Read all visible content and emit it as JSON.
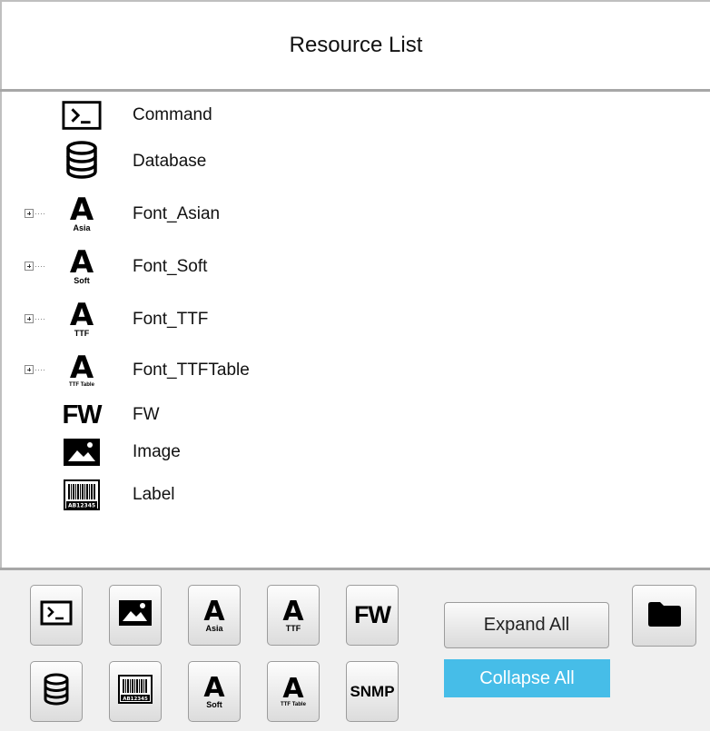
{
  "header": {
    "title": "Resource List"
  },
  "tree": {
    "items": [
      {
        "label": "Command",
        "icon": "terminal-icon",
        "expandable": false
      },
      {
        "label": "Database",
        "icon": "database-icon",
        "expandable": false
      },
      {
        "label": "Font_Asian",
        "icon": "font-asia-icon",
        "icon_sub": "Asia",
        "expandable": true
      },
      {
        "label": "Font_Soft",
        "icon": "font-soft-icon",
        "icon_sub": "Soft",
        "expandable": true
      },
      {
        "label": "Font_TTF",
        "icon": "font-ttf-icon",
        "icon_sub": "TTF",
        "expandable": true
      },
      {
        "label": "Font_TTFTable",
        "icon": "font-ttf-table-icon",
        "icon_sub": "TTF Table",
        "expandable": true
      },
      {
        "label": "FW",
        "icon": "fw-icon",
        "icon_text": "FW",
        "expandable": false
      },
      {
        "label": "Image",
        "icon": "image-icon",
        "expandable": false
      },
      {
        "label": "Label",
        "icon": "barcode-label-icon",
        "barcode_text": "AB12345",
        "expandable": false
      }
    ]
  },
  "toolbar": {
    "buttons": {
      "command": {
        "icon": "terminal-icon"
      },
      "image": {
        "icon": "image-icon"
      },
      "font_asia": {
        "icon": "font-asia-icon",
        "sub": "Asia"
      },
      "font_ttf": {
        "icon": "font-ttf-icon",
        "sub": "TTF"
      },
      "fw": {
        "icon": "fw-icon",
        "text": "FW"
      },
      "database": {
        "icon": "database-icon"
      },
      "label": {
        "icon": "barcode-label-icon",
        "barcode_text": "AB12345"
      },
      "font_soft": {
        "icon": "font-soft-icon",
        "sub": "Soft"
      },
      "font_ttf_table": {
        "icon": "font-ttf-table-icon",
        "sub": "TTF Table"
      },
      "snmp": {
        "icon": "snmp-icon",
        "text": "SNMP"
      },
      "folder": {
        "icon": "folder-icon"
      }
    },
    "expand_all_label": "Expand All",
    "collapse_all_label": "Collapse All"
  },
  "colors": {
    "accent": "#46bde8",
    "accent_text": "#ffffff",
    "divider": "#a7a7a7",
    "toolbar_bg": "#f0f0f0"
  }
}
